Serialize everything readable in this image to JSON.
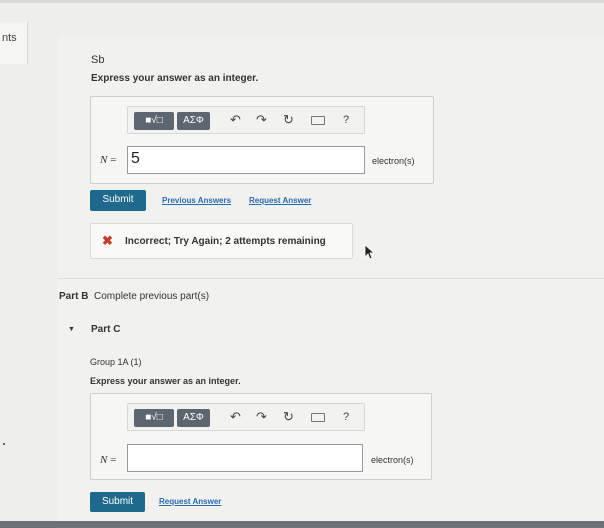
{
  "left_rail": {
    "label": "nts"
  },
  "part_a": {
    "element": "Sb",
    "instruction": "Express your answer as an integer.",
    "toolbar": {
      "template_btn": "■√□",
      "symbol_btn": "ΑΣΦ",
      "help": "?"
    },
    "variable": "N",
    "equals": "=",
    "answer_value": "5",
    "unit": "electron(s)",
    "submit_label": "Submit",
    "previous_answers": "Previous Answers",
    "request_answer": "Request Answer",
    "feedback_icon": "✖",
    "feedback": "Incorrect; Try Again; 2 attempts remaining"
  },
  "part_b": {
    "label": "Part B",
    "status": "Complete previous part(s)"
  },
  "part_c": {
    "caret": "▼",
    "label": "Part C",
    "element": "Group 1A (1)",
    "instruction": "Express your answer as an integer.",
    "toolbar": {
      "template_btn": "■√□",
      "symbol_btn": "ΑΣΦ",
      "help": "?"
    },
    "variable": "N",
    "equals": "=",
    "answer_value": "",
    "unit": "electron(s)",
    "submit_label": "Submit",
    "request_answer": "Request Answer"
  },
  "colors": {
    "submit_bg": "#1f6a8c",
    "link": "#2a6ab0",
    "incorrect": "#c23a2b",
    "toolbar_btn": "#5b6670"
  }
}
